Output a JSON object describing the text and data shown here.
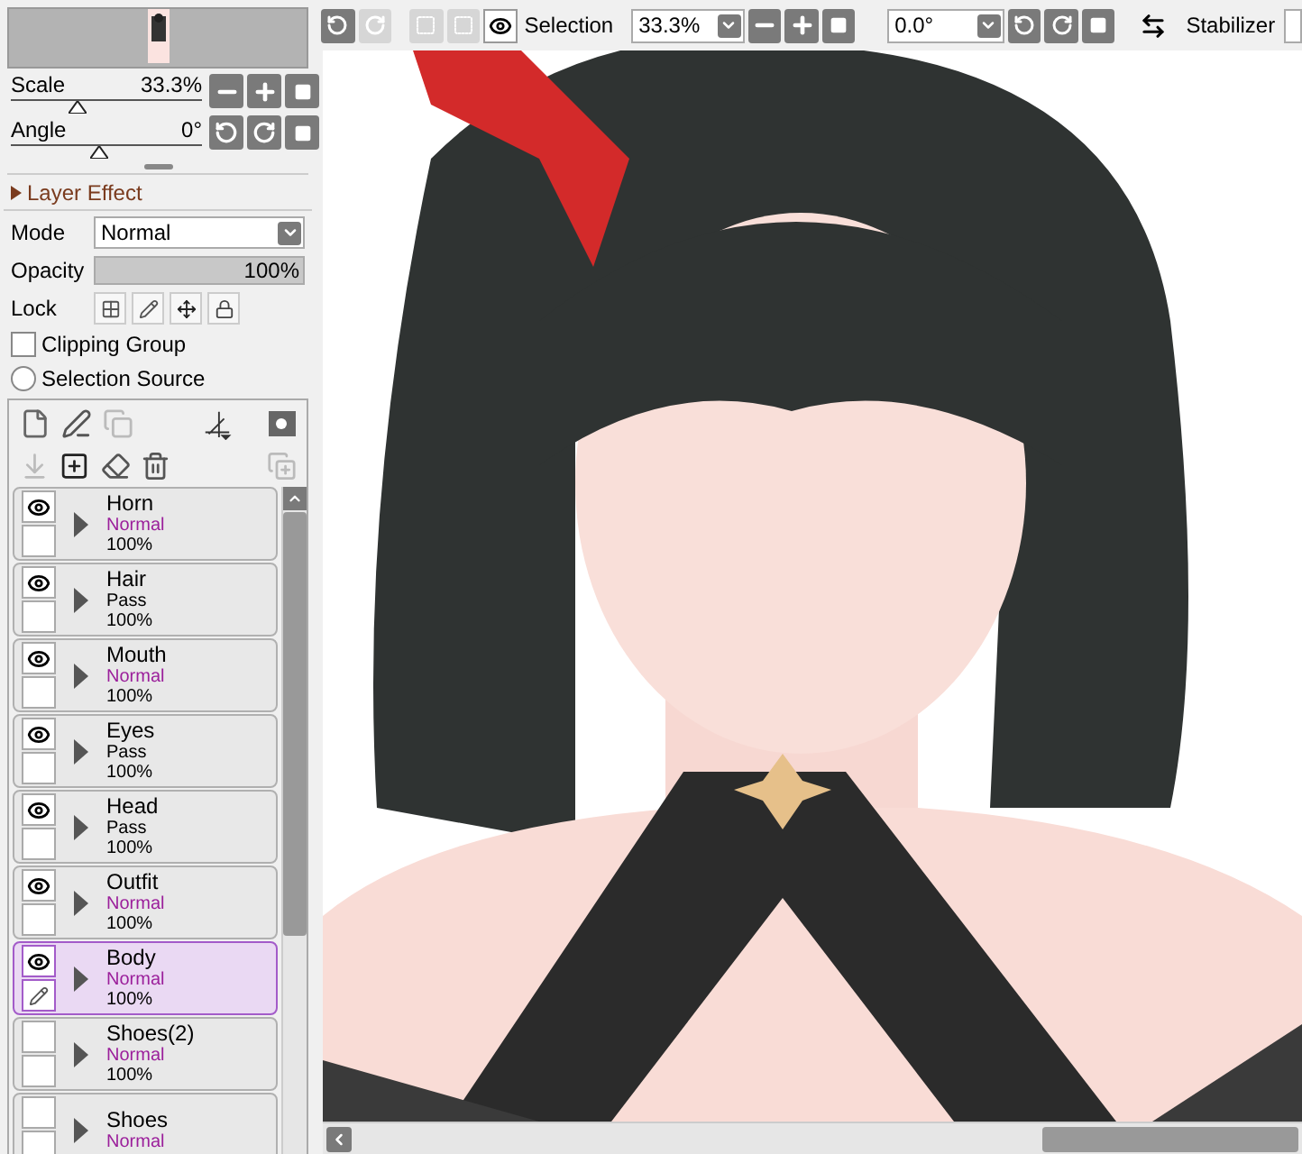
{
  "view": {
    "scale": {
      "label": "Scale",
      "value": "33.3%",
      "level": 0.35
    },
    "angle": {
      "label": "Angle",
      "value": "0°",
      "level": 0.46
    }
  },
  "layer_effect": {
    "label": "Layer Effect",
    "expanded": false
  },
  "mode": {
    "label": "Mode",
    "value": "Normal"
  },
  "opacity": {
    "label": "Opacity",
    "value": "100%",
    "level": 1
  },
  "lock": {
    "label": "Lock"
  },
  "clipping_group": {
    "label": "Clipping Group",
    "checked": false
  },
  "selection_source": {
    "label": "Selection Source",
    "selected": false
  },
  "layers": [
    {
      "name": "Horn",
      "mode": "Normal",
      "color": "#9b1f9b",
      "opacity": "100%",
      "visible": true,
      "selected": false
    },
    {
      "name": "Hair",
      "mode": "Pass",
      "color": "#000000",
      "opacity": "100%",
      "visible": true,
      "selected": false
    },
    {
      "name": "Mouth",
      "mode": "Normal",
      "color": "#9b1f9b",
      "opacity": "100%",
      "visible": true,
      "selected": false
    },
    {
      "name": "Eyes",
      "mode": "Pass",
      "color": "#000000",
      "opacity": "100%",
      "visible": true,
      "selected": false
    },
    {
      "name": "Head",
      "mode": "Pass",
      "color": "#000000",
      "opacity": "100%",
      "visible": true,
      "selected": false
    },
    {
      "name": "Outfit",
      "mode": "Normal",
      "color": "#9b1f9b",
      "opacity": "100%",
      "visible": true,
      "selected": false
    },
    {
      "name": "Body",
      "mode": "Normal",
      "color": "#9b1f9b",
      "opacity": "100%",
      "visible": true,
      "selected": true
    },
    {
      "name": "Shoes(2)",
      "mode": "Normal",
      "color": "#9b1f9b",
      "opacity": "100%",
      "visible": false,
      "selected": false
    },
    {
      "name": "Shoes",
      "mode": "Normal",
      "color": "#9b1f9b",
      "visible": false,
      "selected": false
    }
  ],
  "toolbar": {
    "redo_disabled": true,
    "selection_label": "Selection",
    "selection_visible": true,
    "zoom": "33.3%",
    "angle": "0.0°",
    "stabilizer_label": "Stabilizer"
  }
}
